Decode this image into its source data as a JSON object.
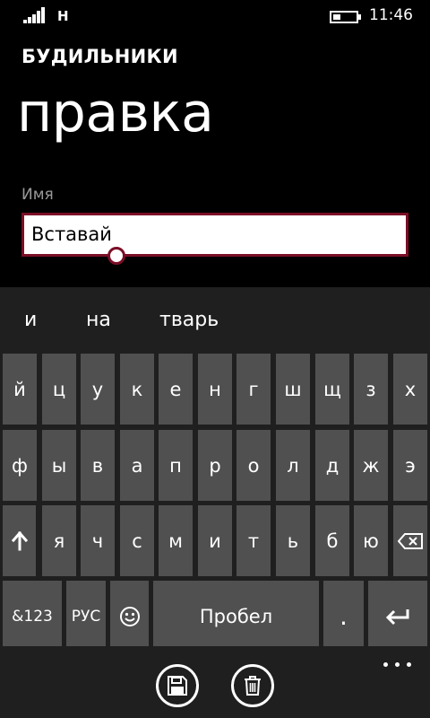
{
  "status_bar": {
    "network": "H",
    "time": "11:46",
    "battery_level": 0.35,
    "signal_bars": 5
  },
  "header": {
    "app_title": "БУДИЛЬНИКИ",
    "page_title": "правка"
  },
  "form": {
    "name_label": "Имя",
    "name_value": "Вставай"
  },
  "keyboard": {
    "suggestions": [
      "и",
      "на",
      "тварь"
    ],
    "row1": [
      "й",
      "ц",
      "у",
      "к",
      "е",
      "н",
      "г",
      "ш",
      "щ",
      "з",
      "х"
    ],
    "row2": [
      "ф",
      "ы",
      "в",
      "а",
      "п",
      "р",
      "о",
      "л",
      "д",
      "ж",
      "э"
    ],
    "row3": [
      "я",
      "ч",
      "с",
      "м",
      "и",
      "т",
      "ь",
      "б",
      "ю"
    ],
    "symbols_label": "&123",
    "language_label": "РУС",
    "space_label": "Пробел",
    "period_label": ".",
    "icons": {
      "shift": "shift-arrow-up-icon",
      "backspace": "backspace-icon",
      "emoji": "smiley-icon",
      "enter": "enter-icon"
    }
  },
  "app_bar": {
    "icons": [
      "save-icon",
      "delete-icon",
      "more-icon"
    ]
  },
  "colors": {
    "accent": "#7a0e26",
    "key": "#505050",
    "keyboard_bg": "#1f1f1f",
    "label_gray": "#9a9a9a"
  }
}
